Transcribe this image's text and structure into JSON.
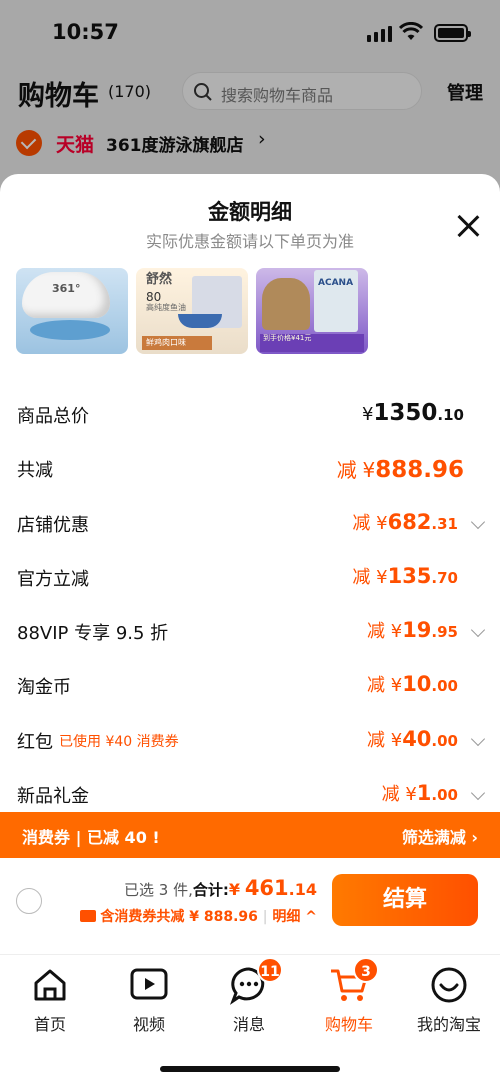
{
  "status_bar": {
    "time": "10:57"
  },
  "cart_header": {
    "title": "购物车",
    "count": "(170)",
    "search_placeholder": "搜索购物车商品",
    "manage_label": "管理"
  },
  "store": {
    "badge": "天猫",
    "name": "361度游泳旗舰店",
    "chevron": "›"
  },
  "sheet": {
    "title": "金额明细",
    "subtitle": "实际优惠金额请以下单页为准"
  },
  "thumbnails": [
    {
      "name": "swim-cap",
      "text": "361°"
    },
    {
      "name": "cat-food",
      "title": "舒然",
      "num": "80",
      "desc": "高纯度鱼油",
      "strip": "鲜鸡肉口味"
    },
    {
      "name": "acana-cat-food",
      "brand": "ACANA",
      "strip": "到手价格¥41元"
    }
  ],
  "detail_rows": [
    {
      "label": "商品总价",
      "prefix": "",
      "currency": "¥",
      "int": "1350",
      "dec": ".10",
      "has_chevron": false,
      "note": ""
    },
    {
      "label": "共减",
      "prefix": "减",
      "currency": "¥",
      "int": "888",
      "dec": ".96",
      "has_chevron": false,
      "note": ""
    },
    {
      "label": "店铺优惠",
      "prefix": "减",
      "currency": "¥",
      "int": "682",
      "dec": ".31",
      "has_chevron": true,
      "note": ""
    },
    {
      "label": "官方立减",
      "prefix": "减",
      "currency": "¥",
      "int": "135",
      "dec": ".70",
      "has_chevron": false,
      "note": ""
    },
    {
      "label": "88VIP 专享 9.5 折",
      "prefix": "减",
      "currency": "¥",
      "int": "19",
      "dec": ".95",
      "has_chevron": true,
      "note": ""
    },
    {
      "label": "淘金币",
      "prefix": "减",
      "currency": "¥",
      "int": "10",
      "dec": ".00",
      "has_chevron": false,
      "note": ""
    },
    {
      "label": "红包",
      "prefix": "减",
      "currency": "¥",
      "int": "40",
      "dec": ".00",
      "has_chevron": true,
      "note": "已使用 ¥40 消费券"
    },
    {
      "label": "新品礼金",
      "prefix": "减",
      "currency": "¥",
      "int": "1",
      "dec": ".00",
      "has_chevron": true,
      "note": ""
    }
  ],
  "coupon_bar": {
    "left": "消费券 | 已减 40 !",
    "right": "筛选满减 ›"
  },
  "checkout": {
    "selected": "已选 3 件,",
    "total_label": "合计:",
    "currency": "¥",
    "price_int": "461",
    "price_dec": ".14",
    "saving": "含消费券共减 ¥ 888.96",
    "detail_label": "明细 ^",
    "pay_label": "结算"
  },
  "tabbar": [
    {
      "label": "首页",
      "icon": "home-icon",
      "badge": ""
    },
    {
      "label": "视频",
      "icon": "video-icon",
      "badge": ""
    },
    {
      "label": "消息",
      "icon": "message-icon",
      "badge": "11"
    },
    {
      "label": "购物车",
      "icon": "cart-icon",
      "badge": "3"
    },
    {
      "label": "我的淘宝",
      "icon": "profile-icon",
      "badge": ""
    }
  ],
  "colors": {
    "accent": "#ff5000",
    "tmall": "#ff0036",
    "coupon_bar": "#ff6a00"
  }
}
